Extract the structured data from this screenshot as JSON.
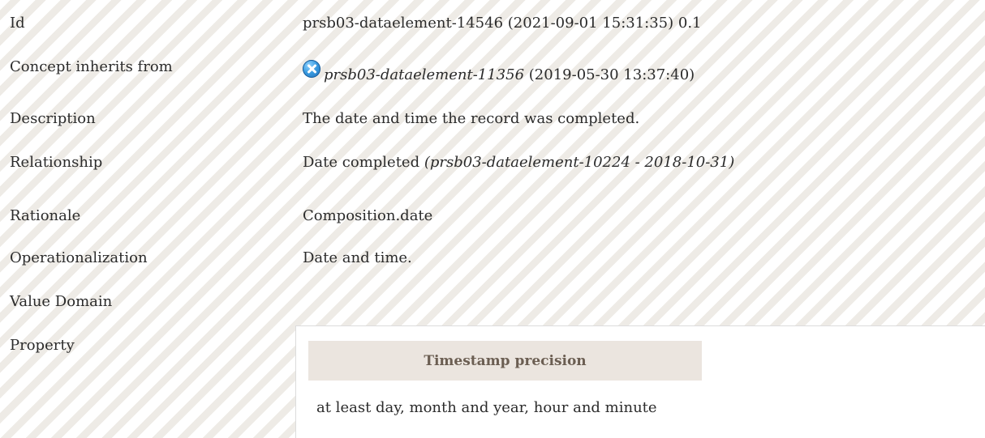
{
  "rows": {
    "id": {
      "label": "Id",
      "value": "prsb03-dataelement-14546 (2021-09-01 15:31:35) 0.1"
    },
    "inherits": {
      "label": "Concept inherits from",
      "ref": "prsb03-dataelement-11356",
      "date": "(2019-05-30 13:37:40)",
      "icon": "inherit-cross-icon"
    },
    "description": {
      "label": "Description",
      "value": "The date and time the record was completed."
    },
    "relationship": {
      "label": "Relationship",
      "value": "Date completed",
      "ref": "(prsb03-dataelement-10224 - 2018-10-31)"
    },
    "rationale": {
      "label": "Rationale",
      "value": "Composition.date"
    },
    "operationalization": {
      "label": "Operationalization",
      "value": "Date and time."
    },
    "value_domain": {
      "label": "Value Domain"
    },
    "property": {
      "label": "Property",
      "header": "Timestamp precision",
      "value": "at least day, month and year, hour and minute"
    }
  },
  "colors": {
    "stripe": "#eeebe6",
    "header_bg": "#ebe5df",
    "header_text": "#6b5e52",
    "icon": "#3a9be0"
  }
}
